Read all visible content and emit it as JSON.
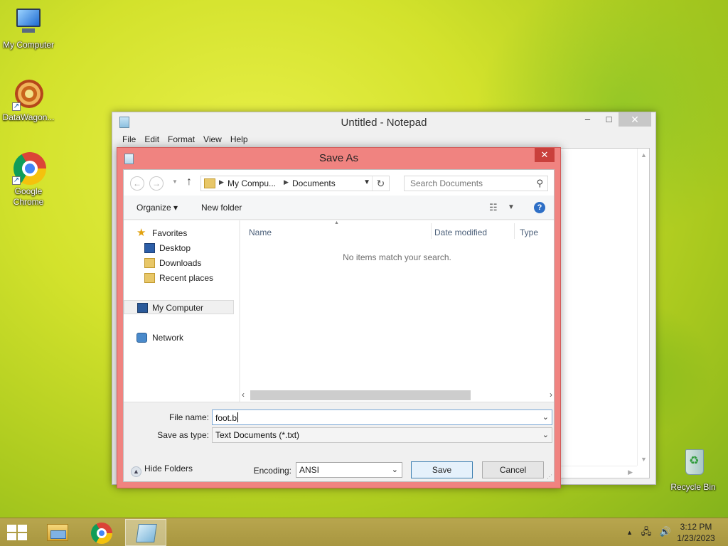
{
  "desktop": {
    "icons": [
      {
        "label": "My Computer"
      },
      {
        "label": "DataWagon..."
      },
      {
        "label": "Google Chrome"
      },
      {
        "label": "Recycle Bin"
      }
    ]
  },
  "notepad": {
    "title": "Untitled - Notepad",
    "menu": [
      "File",
      "Edit",
      "Format",
      "View",
      "Help"
    ],
    "controls": {
      "minimize": "–",
      "maximize": "□",
      "close": "✕"
    }
  },
  "dialog": {
    "title": "Save As",
    "close": "✕",
    "address": {
      "segments": [
        "My Compu...",
        "Documents"
      ]
    },
    "search": {
      "placeholder": "Search Documents"
    },
    "toolbar": {
      "organize": "Organize",
      "new_folder": "New folder"
    },
    "nav_pane": {
      "favorites": "Favorites",
      "desktop": "Desktop",
      "downloads": "Downloads",
      "recent_places": "Recent places",
      "my_computer": "My Computer",
      "network": "Network"
    },
    "columns": {
      "name": "Name",
      "date_modified": "Date modified",
      "type": "Type"
    },
    "empty_message": "No items match your search.",
    "file_name_label": "File name:",
    "file_name_value": "foot.b",
    "save_type_label": "Save as type:",
    "save_type_value": "Text Documents (*.txt)",
    "hide_folders": "Hide Folders",
    "encoding_label": "Encoding:",
    "encoding_value": "ANSI",
    "save_button": "Save",
    "cancel_button": "Cancel"
  },
  "taskbar": {
    "time": "3:12 PM",
    "date": "1/23/2023"
  }
}
